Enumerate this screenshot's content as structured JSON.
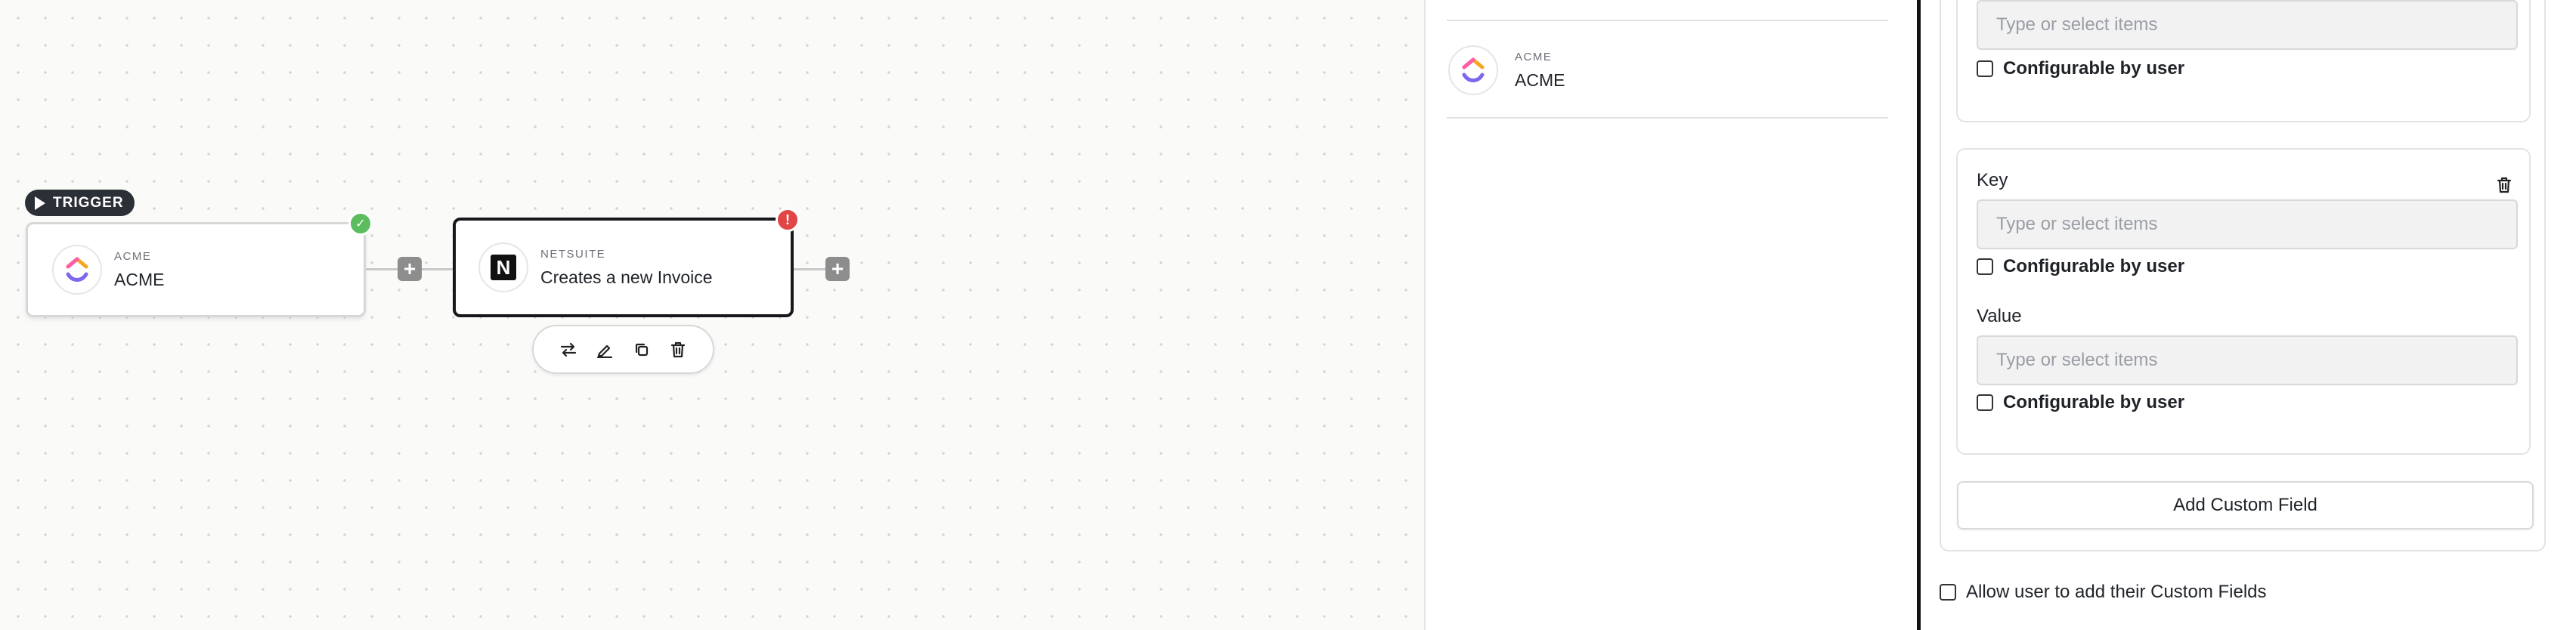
{
  "canvas": {
    "trigger_badge": "TRIGGER",
    "trigger_node": {
      "app": "ACME",
      "name": "ACME",
      "status": "success"
    },
    "action_node": {
      "app": "NETSUITE",
      "name": "Creates a new Invoice",
      "status": "error",
      "logo_letter": "N"
    },
    "add_step_symbol": "+",
    "status_error_symbol": "!",
    "status_ok_symbol": "✓",
    "node_toolbar": [
      "swap-icon",
      "edit-icon",
      "copy-icon",
      "delete-icon"
    ]
  },
  "mid_panel": {
    "item": {
      "app": "ACME",
      "name": "ACME"
    }
  },
  "right_panel": {
    "top_card": {
      "placeholder": "Type or select items",
      "configurable_label": "Configurable by user"
    },
    "custom_field": {
      "key_label": "Key",
      "key_placeholder": "Type or select items",
      "key_configurable_label": "Configurable by user",
      "value_label": "Value",
      "value_placeholder": "Type or select items",
      "value_configurable_label": "Configurable by user"
    },
    "add_custom_field_label": "Add Custom Field",
    "allow_custom_fields_label": "Allow user to add their Custom Fields"
  },
  "colors": {
    "success": "#5cbd5f",
    "error": "#e04646",
    "badge_bg": "#2b2f36",
    "selected_border": "#16181b"
  }
}
